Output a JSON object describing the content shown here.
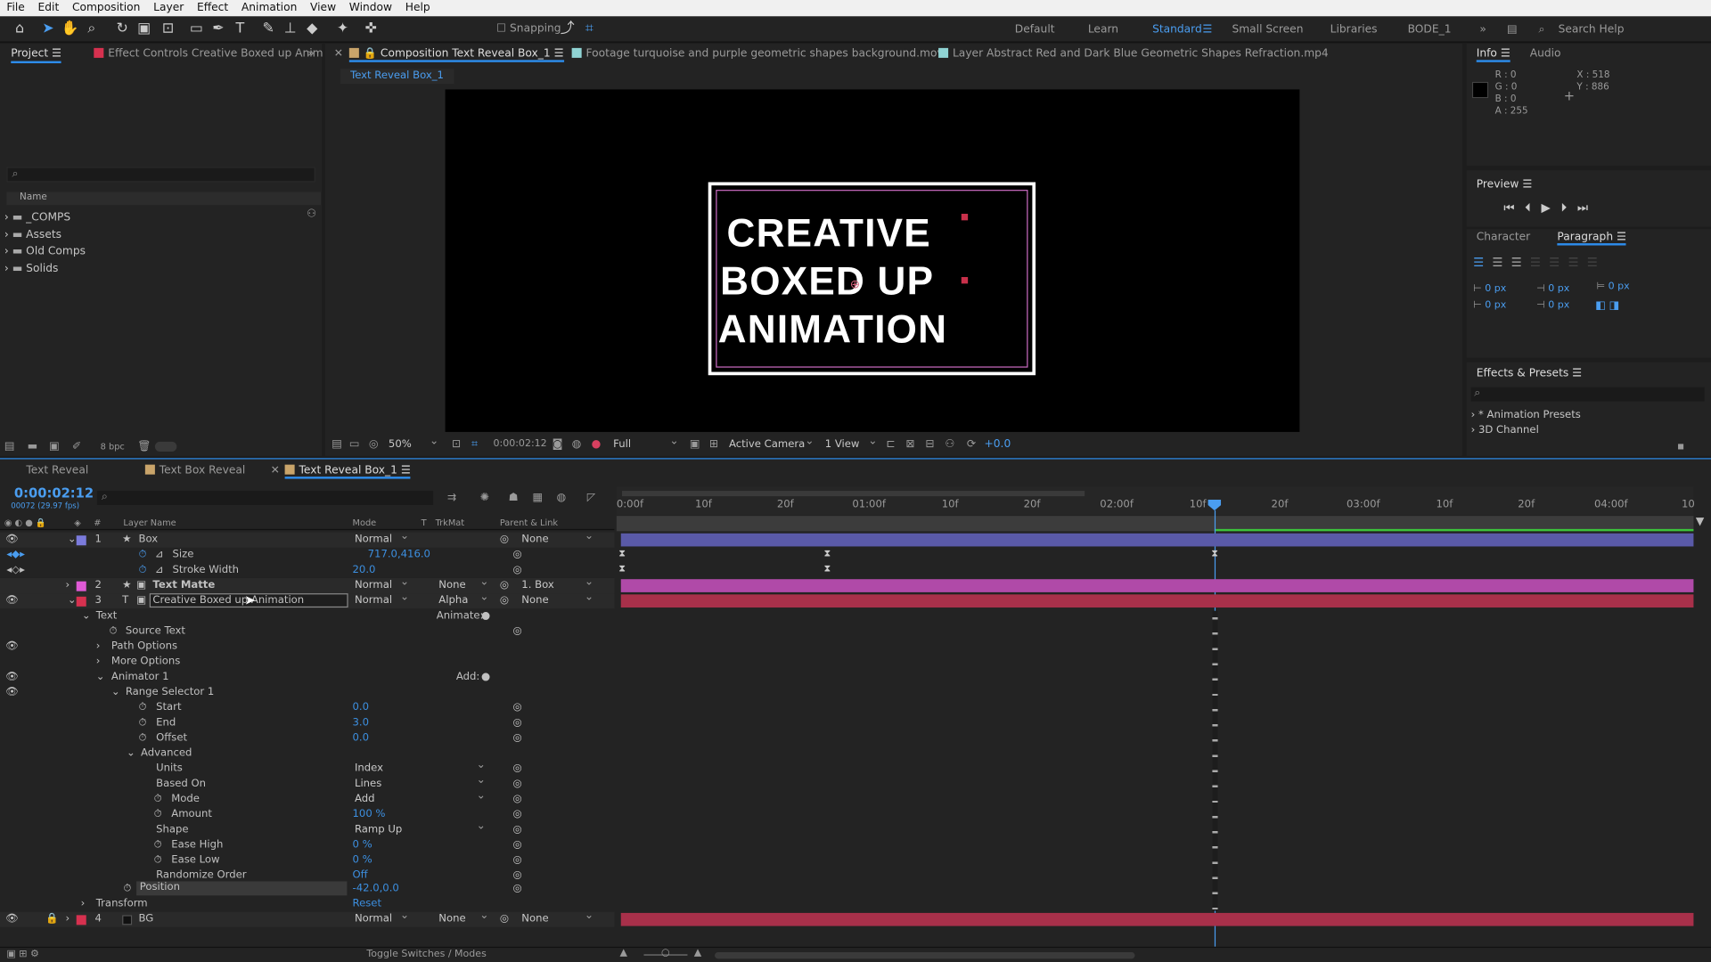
{
  "menu": [
    "File",
    "Edit",
    "Composition",
    "Layer",
    "Effect",
    "Animation",
    "View",
    "Window",
    "Help"
  ],
  "toolbar": {
    "snapping": "Snapping",
    "workspaces": [
      "Default",
      "Learn",
      "Standard",
      "Small Screen",
      "Libraries",
      "BODE_1"
    ],
    "search_placeholder": "Search Help"
  },
  "project": {
    "tab": "Project",
    "effect_tab": "Effect Controls Creative Boxed up Anim",
    "name_header": "Name",
    "folders": [
      "_COMPS",
      "Assets",
      "Old Comps",
      "Solids"
    ],
    "bpc": "8 bpc"
  },
  "viewer": {
    "tabs": [
      "Composition Text Reveal Box_1",
      "Footage turquoise and purple geometric shapes background.mov",
      "Layer Abstract Red and Dark Blue Geometric Shapes Refraction.mp4"
    ],
    "breadcrumb": "Text Reveal Box_1",
    "text_lines": [
      "CREATIVE",
      "BOXED UP",
      "ANIMATION"
    ],
    "zoom": "50%",
    "timecode": "0:00:02:12",
    "resolution": "Full",
    "camera": "Active Camera",
    "views": "1 View",
    "exposure": "+0.0"
  },
  "info": {
    "tabs": [
      "Info",
      "Audio"
    ],
    "r": "R : 0",
    "g": "G : 0",
    "b": "B : 0",
    "a": "A : 255",
    "x": "X : 518",
    "y": "Y : 886"
  },
  "preview": {
    "title": "Preview"
  },
  "paragraph": {
    "tabs": [
      "Character",
      "Paragraph"
    ],
    "values": [
      "0 px",
      "0 px",
      "0 px",
      "0 px",
      "0 px"
    ]
  },
  "effects": {
    "title": "Effects & Presets",
    "items": [
      "* Animation Presets",
      "3D Channel"
    ]
  },
  "timeline": {
    "tabs": [
      "Text Reveal",
      "Text Box Reveal",
      "Text Reveal Box_1"
    ],
    "timecode": "0:00:02:12",
    "fps": "00072 (29.97 fps)",
    "headers": {
      "layer_name": "Layer Name",
      "mode": "Mode",
      "t": "T",
      "trkmat": "TrkMat",
      "parent": "Parent & Link"
    },
    "ruler": [
      "0:00f",
      "10f",
      "20f",
      "01:00f",
      "10f",
      "20f",
      "02:00f",
      "10f",
      "20f",
      "03:00f",
      "10f",
      "20f",
      "04:00f",
      "10"
    ],
    "rows": {
      "l1": {
        "num": "1",
        "name": "Box",
        "mode": "Normal",
        "parent": "None"
      },
      "size": {
        "name": "Size",
        "value": "717.0,416.0"
      },
      "stroke": {
        "name": "Stroke Width",
        "value": "20.0"
      },
      "l2": {
        "num": "2",
        "name": "Text Matte",
        "mode": "Normal",
        "trk": "None",
        "parent": "1. Box"
      },
      "l3": {
        "num": "3",
        "name": "Creative Boxed up Animation",
        "mode": "Normal",
        "trk": "Alpha",
        "parent": "None"
      },
      "text": {
        "name": "Text",
        "animate": "Animate:"
      },
      "source": {
        "name": "Source Text"
      },
      "path": {
        "name": "Path Options"
      },
      "more": {
        "name": "More Options"
      },
      "anim1": {
        "name": "Animator 1",
        "add": "Add:"
      },
      "range": {
        "name": "Range Selector 1"
      },
      "start": {
        "name": "Start",
        "value": "0.0"
      },
      "end": {
        "name": "End",
        "value": "3.0"
      },
      "offset": {
        "name": "Offset",
        "value": "0.0"
      },
      "adv": {
        "name": "Advanced"
      },
      "units": {
        "name": "Units",
        "value": "Index"
      },
      "based": {
        "name": "Based On",
        "value": "Lines"
      },
      "mode": {
        "name": "Mode",
        "value": "Add"
      },
      "amount": {
        "name": "Amount",
        "value": "100 %"
      },
      "shape": {
        "name": "Shape",
        "value": "Ramp Up"
      },
      "easeh": {
        "name": "Ease High",
        "value": "0 %"
      },
      "easel": {
        "name": "Ease Low",
        "value": "0 %"
      },
      "rand": {
        "name": "Randomize Order",
        "value": "Off"
      },
      "pos": {
        "name": "Position",
        "value": "-42.0,0.0"
      },
      "transform": {
        "name": "Transform",
        "value": "Reset"
      },
      "l4": {
        "num": "4",
        "name": "BG",
        "mode": "Normal",
        "trk": "None",
        "parent": "None"
      }
    },
    "footer": "Toggle Switches / Modes"
  },
  "colors": {
    "accent": "#2d8ceb",
    "box_label": "#7b7bdc",
    "matte_label": "#e05ad6",
    "text_label": "#d6314f",
    "bar_box": "#5a5aa8",
    "bar_matte": "#b04aa8",
    "bar_text": "#a8304a"
  }
}
